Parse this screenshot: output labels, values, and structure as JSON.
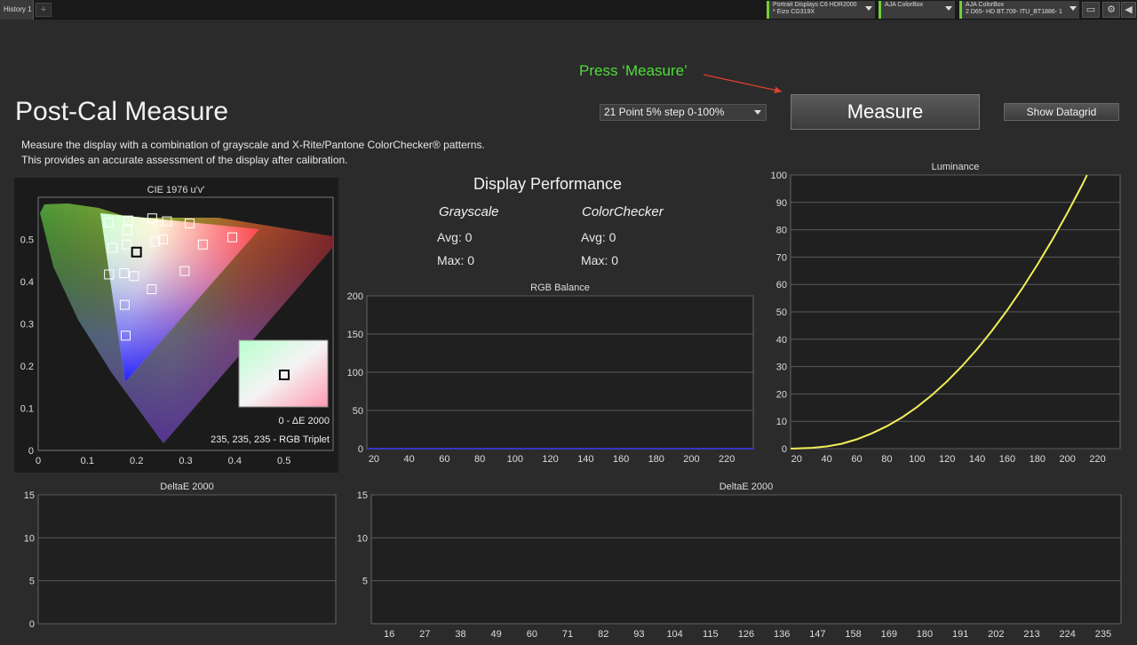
{
  "tabs": {
    "history": "History 1",
    "add": "+"
  },
  "devices": [
    {
      "line1": "Portrait Displays C6 HDR2000",
      "line2": "* Eizo CG319X"
    },
    {
      "line1": "AJA ColorBox",
      "line2": ""
    },
    {
      "line1": "AJA ColorBox",
      "line2": "2 D65- HD BT.709- ITU_BT1886- 1"
    }
  ],
  "page": {
    "title": "Post-Cal Measure",
    "desc1": "Measure the display with a combination of grayscale and X-Rite/Pantone ColorChecker® patterns.",
    "desc2": "This provides an accurate assessment of the display after calibration.",
    "annotation": "Press ‘Measure’"
  },
  "controls": {
    "pattern_select": "21 Point 5% step 0-100%",
    "measure_button": "Measure",
    "datagrid_button": "Show Datagrid"
  },
  "performance": {
    "title": "Display Performance",
    "grayscale": {
      "label": "Grayscale",
      "avg": "Avg: 0",
      "max": "Max: 0"
    },
    "colorchecker": {
      "label": "ColorChecker",
      "avg": "Avg: 0",
      "max": "Max: 0"
    }
  },
  "cie": {
    "delta_label": "0 - ΔE 2000",
    "triplet_label": "235, 235, 235 - RGB Triplet"
  },
  "chart_data": [
    {
      "id": "cie",
      "type": "scatter",
      "title": "CIE 1976 u'v'",
      "xlabel": "",
      "ylabel": "",
      "xlim": [
        0,
        0.6
      ],
      "ylim": [
        0,
        0.6
      ],
      "xticks": [
        0,
        0.1,
        0.2,
        0.3,
        0.4,
        0.5
      ],
      "yticks": [
        0,
        0.1,
        0.2,
        0.3,
        0.4,
        0.5
      ],
      "points": [
        [
          0.143,
          0.54
        ],
        [
          0.183,
          0.545
        ],
        [
          0.232,
          0.55
        ],
        [
          0.262,
          0.543
        ],
        [
          0.308,
          0.538
        ],
        [
          0.181,
          0.522
        ],
        [
          0.238,
          0.495
        ],
        [
          0.254,
          0.5
        ],
        [
          0.335,
          0.488
        ],
        [
          0.395,
          0.505
        ],
        [
          0.151,
          0.48
        ],
        [
          0.18,
          0.488
        ],
        [
          0.144,
          0.417
        ],
        [
          0.175,
          0.42
        ],
        [
          0.195,
          0.413
        ],
        [
          0.298,
          0.425
        ],
        [
          0.231,
          0.382
        ],
        [
          0.176,
          0.345
        ],
        [
          0.178,
          0.272
        ]
      ],
      "selected": [
        0.2,
        0.47
      ],
      "grid": false
    },
    {
      "id": "rgb",
      "type": "line",
      "title": "RGB Balance",
      "xlim": [
        16,
        235
      ],
      "ylim": [
        0,
        200
      ],
      "xticks": [
        20,
        40,
        60,
        80,
        100,
        120,
        140,
        160,
        180,
        200,
        220
      ],
      "yticks": [
        0,
        50,
        100,
        150,
        200
      ],
      "series": [
        {
          "color": "#3b3bff",
          "values": [
            [
              16,
              0
            ],
            [
              235,
              0
            ]
          ]
        }
      ],
      "grid": true
    },
    {
      "id": "lum",
      "type": "line",
      "title": "Luminance",
      "xlim": [
        16,
        235
      ],
      "ylim": [
        0,
        100
      ],
      "xticks": [
        20,
        40,
        60,
        80,
        100,
        120,
        140,
        160,
        180,
        200,
        220
      ],
      "yticks": [
        0,
        10,
        20,
        30,
        40,
        50,
        60,
        70,
        80,
        90,
        100
      ],
      "series": [
        {
          "color": "#f2ee5a",
          "values": [
            [
              16,
              0
            ],
            [
              30,
              0.3
            ],
            [
              40,
              0.8
            ],
            [
              50,
              1.8
            ],
            [
              60,
              3.4
            ],
            [
              70,
              5.6
            ],
            [
              80,
              8.2
            ],
            [
              90,
              11.4
            ],
            [
              100,
              15.2
            ],
            [
              110,
              19.6
            ],
            [
              120,
              24.6
            ],
            [
              130,
              30.2
            ],
            [
              140,
              36.4
            ],
            [
              150,
              43.2
            ],
            [
              160,
              50.6
            ],
            [
              170,
              58.6
            ],
            [
              180,
              67.2
            ],
            [
              190,
              76.4
            ],
            [
              200,
              86.2
            ],
            [
              210,
              96.6
            ],
            [
              213,
              100
            ]
          ]
        }
      ],
      "grid": true
    },
    {
      "id": "de_small",
      "type": "bar",
      "title": "DeltaE 2000",
      "ylim": [
        0,
        15
      ],
      "yticks": [
        0,
        5,
        10,
        15
      ],
      "categories": [],
      "values": [],
      "grid": true
    },
    {
      "id": "de_large",
      "type": "bar",
      "title": "DeltaE 2000",
      "ylim": [
        0,
        15
      ],
      "yticks": [
        5,
        10,
        15
      ],
      "categories": [
        "16",
        "27",
        "38",
        "49",
        "60",
        "71",
        "82",
        "93",
        "104",
        "115",
        "126",
        "136",
        "147",
        "158",
        "169",
        "180",
        "191",
        "202",
        "213",
        "224",
        "235"
      ],
      "values": [],
      "grid": true
    }
  ]
}
